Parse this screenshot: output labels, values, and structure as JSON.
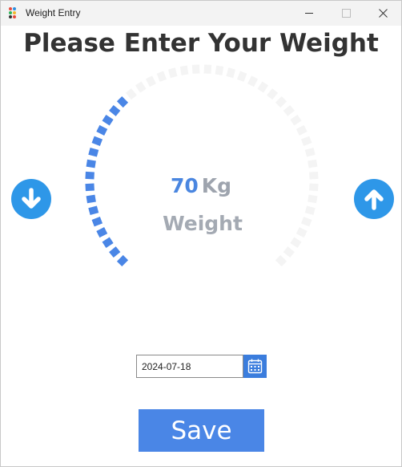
{
  "window": {
    "title": "Weight Entry"
  },
  "page": {
    "heading": "Please Enter Your Weight"
  },
  "gauge": {
    "value": "70",
    "unit": "Kg",
    "label": "Weight",
    "fill_fraction": 0.35,
    "active_color": "#4a86e6",
    "track_color": "#f4f4f4"
  },
  "date": {
    "value": "2024-07-18"
  },
  "actions": {
    "save_label": "Save",
    "decrease_icon": "arrow-down-circle-icon",
    "increase_icon": "arrow-up-circle-icon",
    "calendar_icon": "calendar-icon"
  },
  "colors": {
    "accent": "#4a86e6",
    "arrow_button": "#2e97e8",
    "heading": "#333333",
    "muted_text": "#a4aab3"
  }
}
